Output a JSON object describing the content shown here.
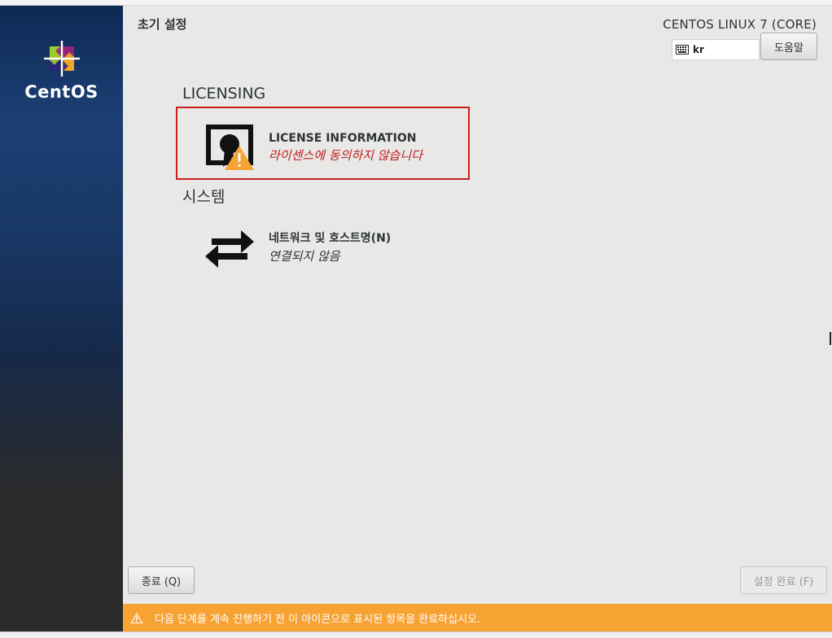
{
  "sidebar": {
    "brand": "CentOS"
  },
  "header": {
    "title": "초기 설정",
    "product": "CENTOS LINUX 7 (CORE)",
    "keyboard_layout": "kr",
    "help_label": "도움말"
  },
  "sections": [
    {
      "title": "LICENSING",
      "spokes": [
        {
          "name": "LICENSE INFORMATION",
          "status": "라이센스에 동의하지 않습니다",
          "icon": "license-warning-icon"
        }
      ]
    },
    {
      "title": "시스템",
      "spokes": [
        {
          "name": "네트워크 및 호스트명(N)",
          "status": "연결되지 않음",
          "icon": "network-arrows-icon"
        }
      ]
    }
  ],
  "footer": {
    "quit_label": "종료 (Q)",
    "finish_label": "설정 완료 (F)"
  },
  "warning_bar": {
    "text": "다음 단계를 계속 진행하기 전 이 아이콘으로 표시된 항목을 완료하십시오."
  },
  "colors": {
    "warning": "#f7a334",
    "error_text": "#c01c1c",
    "highlight_border": "#cc1e1e"
  }
}
